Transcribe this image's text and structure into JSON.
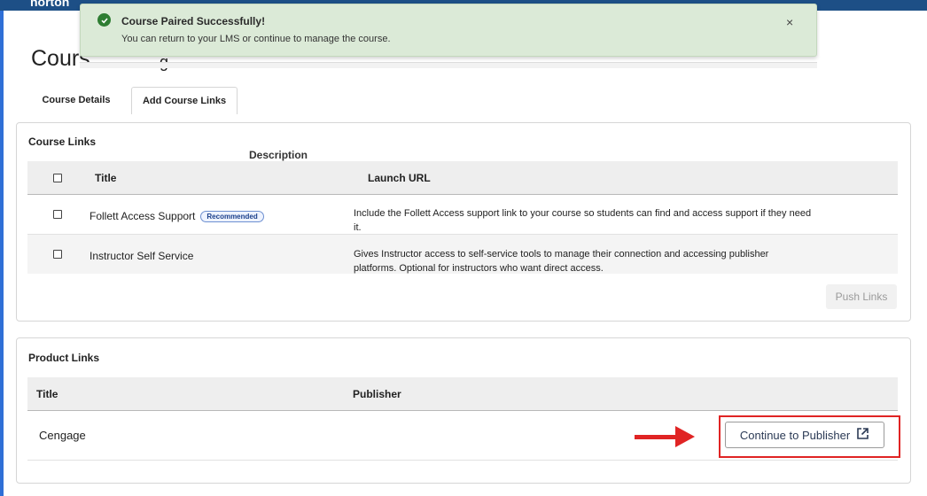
{
  "header": {
    "brand_fragment": "norton"
  },
  "page": {
    "title": "Cours",
    "title_tail": "g"
  },
  "toast": {
    "title": "Course Paired Successfully!",
    "message": "You can return to your LMS or continue to manage the course.",
    "close_glyph": "×",
    "icon": "check-circle-icon"
  },
  "tabs": [
    {
      "label": "Course Details"
    },
    {
      "label": "Add Course Links"
    }
  ],
  "course_links": {
    "title": "Course Links",
    "floating_header": "Description",
    "headers": {
      "title": "Title",
      "launch_url": "Launch URL"
    },
    "rows": [
      {
        "title": "Follett Access Support",
        "badge": "Recommended",
        "description": "Include the Follett Access support link to your course so students can find and access support if they need it."
      },
      {
        "title": "Instructor Self Service",
        "description": "Gives Instructor access to self-service tools to manage their connection and accessing publisher platforms. Optional for instructors who want direct access."
      }
    ],
    "push_button": "Push Links"
  },
  "product_links": {
    "title": "Product Links",
    "headers": {
      "title": "Title",
      "publisher": "Publisher"
    },
    "rows": [
      {
        "title": "Cengage",
        "action": "Continue to Publisher"
      }
    ]
  },
  "colors": {
    "accent_red": "#e02424",
    "success_green": "#2e7d32",
    "toast_bg": "#dbead7"
  }
}
